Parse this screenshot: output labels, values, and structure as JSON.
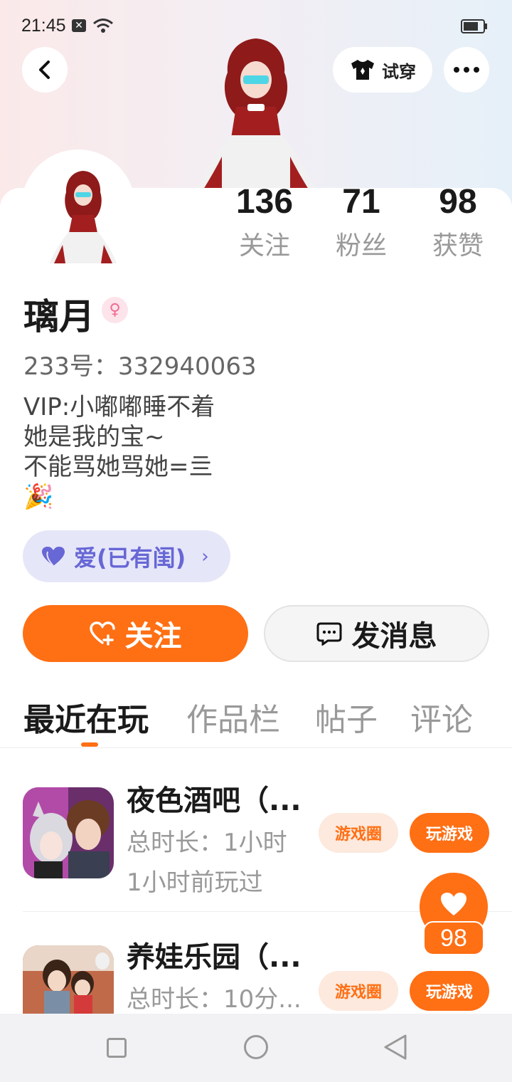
{
  "status": {
    "time": "21:45",
    "notif_icon": "x-icon",
    "wifi_icon": "wifi-icon",
    "battery_icon": "battery-icon"
  },
  "header": {
    "tryon_label": "试穿",
    "back_icon": "chevron-left-icon",
    "more_icon": "more-dots-icon",
    "shirt_icon": "shirt-icon"
  },
  "stats": [
    {
      "value": "136",
      "label": "关注"
    },
    {
      "value": "71",
      "label": "粉丝"
    },
    {
      "value": "98",
      "label": "获赞"
    }
  ],
  "profile": {
    "name": "璃月",
    "gender_icon": "female-symbol-icon",
    "uid": "233号：332940063",
    "bio": "VIP:小嘟嘟睡不着\n她是我的宝~\n不能骂她骂她=亖\n🎉",
    "relationship": "爱(已有闺)"
  },
  "actions": {
    "follow": "关注",
    "message": "发消息"
  },
  "tabs": [
    {
      "label": "最近在玩",
      "active": true
    },
    {
      "label": "作品栏",
      "active": false
    },
    {
      "label": "帖子",
      "active": false
    },
    {
      "label": "评论",
      "active": false
    }
  ],
  "games": [
    {
      "title": "夜色酒吧（...",
      "duration": "总时长：1小时",
      "last_played": "1小时前玩过",
      "circle_label": "游戏圈",
      "play_label": "玩游戏"
    },
    {
      "title": "养娃乐园（...",
      "duration": "总时长：10分...",
      "last_played": "",
      "circle_label": "游戏圈",
      "play_label": "玩游戏"
    }
  ],
  "like": {
    "count": "98"
  },
  "colors": {
    "accent": "#ff6f14",
    "lavender": "#e6e6f9",
    "lavender_text": "#6767d6"
  }
}
